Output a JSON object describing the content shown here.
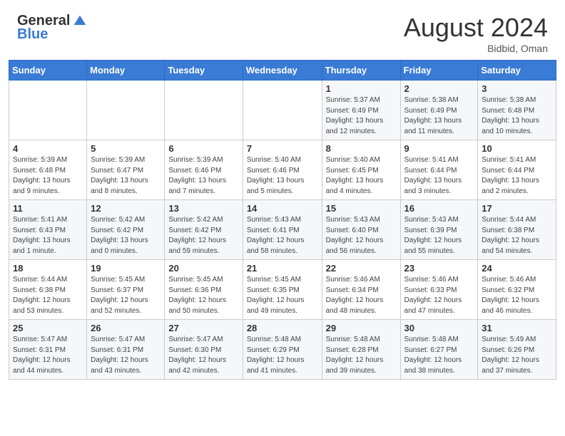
{
  "header": {
    "logo_general": "General",
    "logo_blue": "Blue",
    "month_title": "August 2024",
    "subtitle": "Bidbid, Oman"
  },
  "days_of_week": [
    "Sunday",
    "Monday",
    "Tuesday",
    "Wednesday",
    "Thursday",
    "Friday",
    "Saturday"
  ],
  "weeks": [
    [
      {
        "day": "",
        "info": ""
      },
      {
        "day": "",
        "info": ""
      },
      {
        "day": "",
        "info": ""
      },
      {
        "day": "",
        "info": ""
      },
      {
        "day": "1",
        "info": "Sunrise: 5:37 AM\nSunset: 6:49 PM\nDaylight: 13 hours\nand 12 minutes."
      },
      {
        "day": "2",
        "info": "Sunrise: 5:38 AM\nSunset: 6:49 PM\nDaylight: 13 hours\nand 11 minutes."
      },
      {
        "day": "3",
        "info": "Sunrise: 5:38 AM\nSunset: 6:48 PM\nDaylight: 13 hours\nand 10 minutes."
      }
    ],
    [
      {
        "day": "4",
        "info": "Sunrise: 5:39 AM\nSunset: 6:48 PM\nDaylight: 13 hours\nand 9 minutes."
      },
      {
        "day": "5",
        "info": "Sunrise: 5:39 AM\nSunset: 6:47 PM\nDaylight: 13 hours\nand 8 minutes."
      },
      {
        "day": "6",
        "info": "Sunrise: 5:39 AM\nSunset: 6:46 PM\nDaylight: 13 hours\nand 7 minutes."
      },
      {
        "day": "7",
        "info": "Sunrise: 5:40 AM\nSunset: 6:46 PM\nDaylight: 13 hours\nand 5 minutes."
      },
      {
        "day": "8",
        "info": "Sunrise: 5:40 AM\nSunset: 6:45 PM\nDaylight: 13 hours\nand 4 minutes."
      },
      {
        "day": "9",
        "info": "Sunrise: 5:41 AM\nSunset: 6:44 PM\nDaylight: 13 hours\nand 3 minutes."
      },
      {
        "day": "10",
        "info": "Sunrise: 5:41 AM\nSunset: 6:44 PM\nDaylight: 13 hours\nand 2 minutes."
      }
    ],
    [
      {
        "day": "11",
        "info": "Sunrise: 5:41 AM\nSunset: 6:43 PM\nDaylight: 13 hours\nand 1 minute."
      },
      {
        "day": "12",
        "info": "Sunrise: 5:42 AM\nSunset: 6:42 PM\nDaylight: 13 hours\nand 0 minutes."
      },
      {
        "day": "13",
        "info": "Sunrise: 5:42 AM\nSunset: 6:42 PM\nDaylight: 12 hours\nand 59 minutes."
      },
      {
        "day": "14",
        "info": "Sunrise: 5:43 AM\nSunset: 6:41 PM\nDaylight: 12 hours\nand 58 minutes."
      },
      {
        "day": "15",
        "info": "Sunrise: 5:43 AM\nSunset: 6:40 PM\nDaylight: 12 hours\nand 56 minutes."
      },
      {
        "day": "16",
        "info": "Sunrise: 5:43 AM\nSunset: 6:39 PM\nDaylight: 12 hours\nand 55 minutes."
      },
      {
        "day": "17",
        "info": "Sunrise: 5:44 AM\nSunset: 6:38 PM\nDaylight: 12 hours\nand 54 minutes."
      }
    ],
    [
      {
        "day": "18",
        "info": "Sunrise: 5:44 AM\nSunset: 6:38 PM\nDaylight: 12 hours\nand 53 minutes."
      },
      {
        "day": "19",
        "info": "Sunrise: 5:45 AM\nSunset: 6:37 PM\nDaylight: 12 hours\nand 52 minutes."
      },
      {
        "day": "20",
        "info": "Sunrise: 5:45 AM\nSunset: 6:36 PM\nDaylight: 12 hours\nand 50 minutes."
      },
      {
        "day": "21",
        "info": "Sunrise: 5:45 AM\nSunset: 6:35 PM\nDaylight: 12 hours\nand 49 minutes."
      },
      {
        "day": "22",
        "info": "Sunrise: 5:46 AM\nSunset: 6:34 PM\nDaylight: 12 hours\nand 48 minutes."
      },
      {
        "day": "23",
        "info": "Sunrise: 5:46 AM\nSunset: 6:33 PM\nDaylight: 12 hours\nand 47 minutes."
      },
      {
        "day": "24",
        "info": "Sunrise: 5:46 AM\nSunset: 6:32 PM\nDaylight: 12 hours\nand 46 minutes."
      }
    ],
    [
      {
        "day": "25",
        "info": "Sunrise: 5:47 AM\nSunset: 6:31 PM\nDaylight: 12 hours\nand 44 minutes."
      },
      {
        "day": "26",
        "info": "Sunrise: 5:47 AM\nSunset: 6:31 PM\nDaylight: 12 hours\nand 43 minutes."
      },
      {
        "day": "27",
        "info": "Sunrise: 5:47 AM\nSunset: 6:30 PM\nDaylight: 12 hours\nand 42 minutes."
      },
      {
        "day": "28",
        "info": "Sunrise: 5:48 AM\nSunset: 6:29 PM\nDaylight: 12 hours\nand 41 minutes."
      },
      {
        "day": "29",
        "info": "Sunrise: 5:48 AM\nSunset: 6:28 PM\nDaylight: 12 hours\nand 39 minutes."
      },
      {
        "day": "30",
        "info": "Sunrise: 5:48 AM\nSunset: 6:27 PM\nDaylight: 12 hours\nand 38 minutes."
      },
      {
        "day": "31",
        "info": "Sunrise: 5:49 AM\nSunset: 6:26 PM\nDaylight: 12 hours\nand 37 minutes."
      }
    ]
  ]
}
